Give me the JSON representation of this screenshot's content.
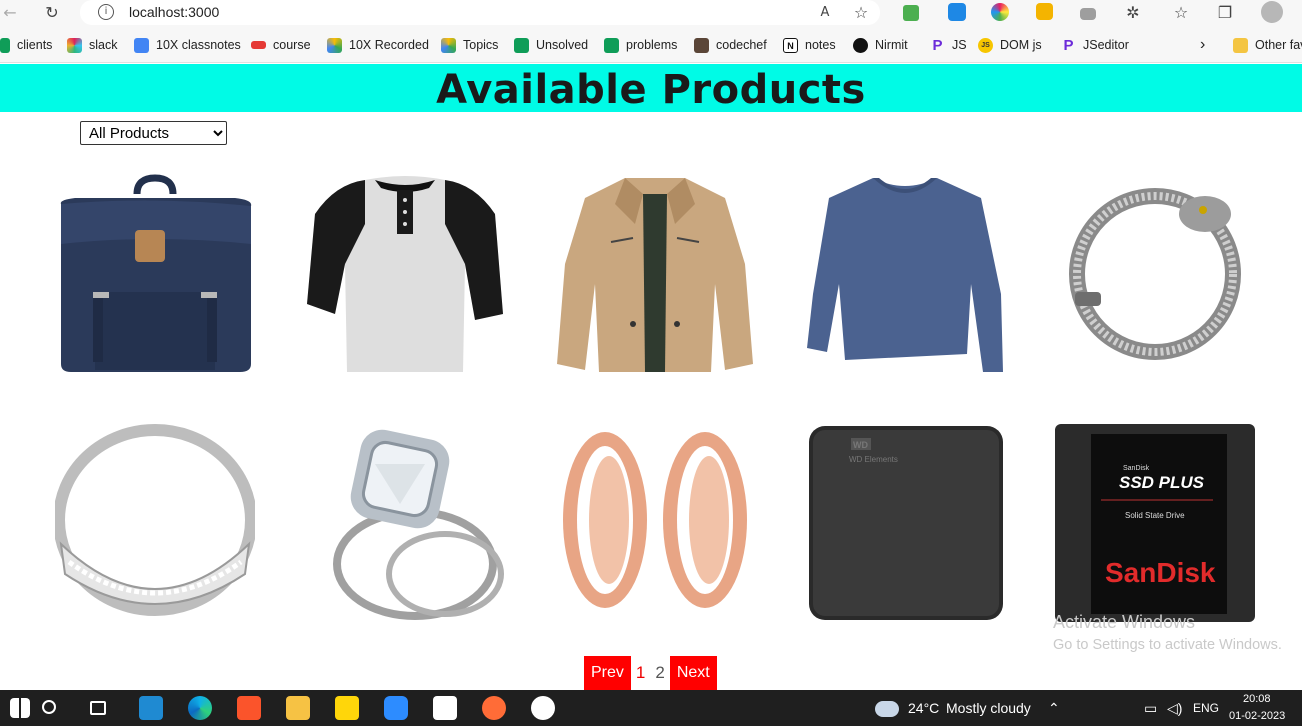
{
  "browser": {
    "url": "localhost:3000",
    "bookmarks": [
      {
        "label": "clients",
        "color": "#0f9d58"
      },
      {
        "label": "slack",
        "color": "#e01e5a"
      },
      {
        "label": "10X classnotes",
        "color": "#4285f4"
      },
      {
        "label": "course",
        "color": "#e53935"
      },
      {
        "label": "10X Recorded",
        "color": "#fbbc04"
      },
      {
        "label": "Topics",
        "color": "#34a853"
      },
      {
        "label": "Unsolved",
        "color": "#0f9d58"
      },
      {
        "label": "problems",
        "color": "#0f9d58"
      },
      {
        "label": "codechef",
        "color": "#5b4638"
      },
      {
        "label": "notes",
        "color": "#111111"
      },
      {
        "label": "Nirmit",
        "color": "#111111"
      },
      {
        "label": "JS",
        "color": "#6c2bd9"
      },
      {
        "label": "DOM js",
        "color": "#f7c600"
      },
      {
        "label": "JSeditor",
        "color": "#6c2bd9"
      }
    ],
    "other_favorites": "Other fav"
  },
  "page": {
    "title": "Available Products",
    "filter": {
      "selected": "All Products"
    },
    "products": [
      {
        "icon": "backpack-image"
      },
      {
        "icon": "raglan-tshirt-image"
      },
      {
        "icon": "jacket-image"
      },
      {
        "icon": "long-sleeve-shirt-image"
      },
      {
        "icon": "dragon-bracelet-image"
      },
      {
        "icon": "silver-ring-image"
      },
      {
        "icon": "diamond-ring-image"
      },
      {
        "icon": "rose-gold-plugs-image"
      },
      {
        "icon": "wd-hard-drive-image"
      },
      {
        "icon": "sandisk-ssd-image"
      }
    ],
    "product_text": {
      "wd_logo": "WD",
      "wd_model": "WD Elements",
      "ssd_brand_small": "SanDisk",
      "ssd_name": "SSD PLUS",
      "ssd_sub": "Solid State Drive",
      "ssd_brand": "SanDisk"
    },
    "pagination": {
      "prev": "Prev",
      "page1": "1",
      "page2": "2",
      "next": "Next"
    }
  },
  "watermark": {
    "line1": "Activate Windows",
    "line2": "Go to Settings to activate Windows."
  },
  "taskbar": {
    "weather_temp": "24°C",
    "weather_desc": "Mostly cloudy",
    "lang": "ENG",
    "time": "20:08",
    "date": "01-02-2023"
  }
}
